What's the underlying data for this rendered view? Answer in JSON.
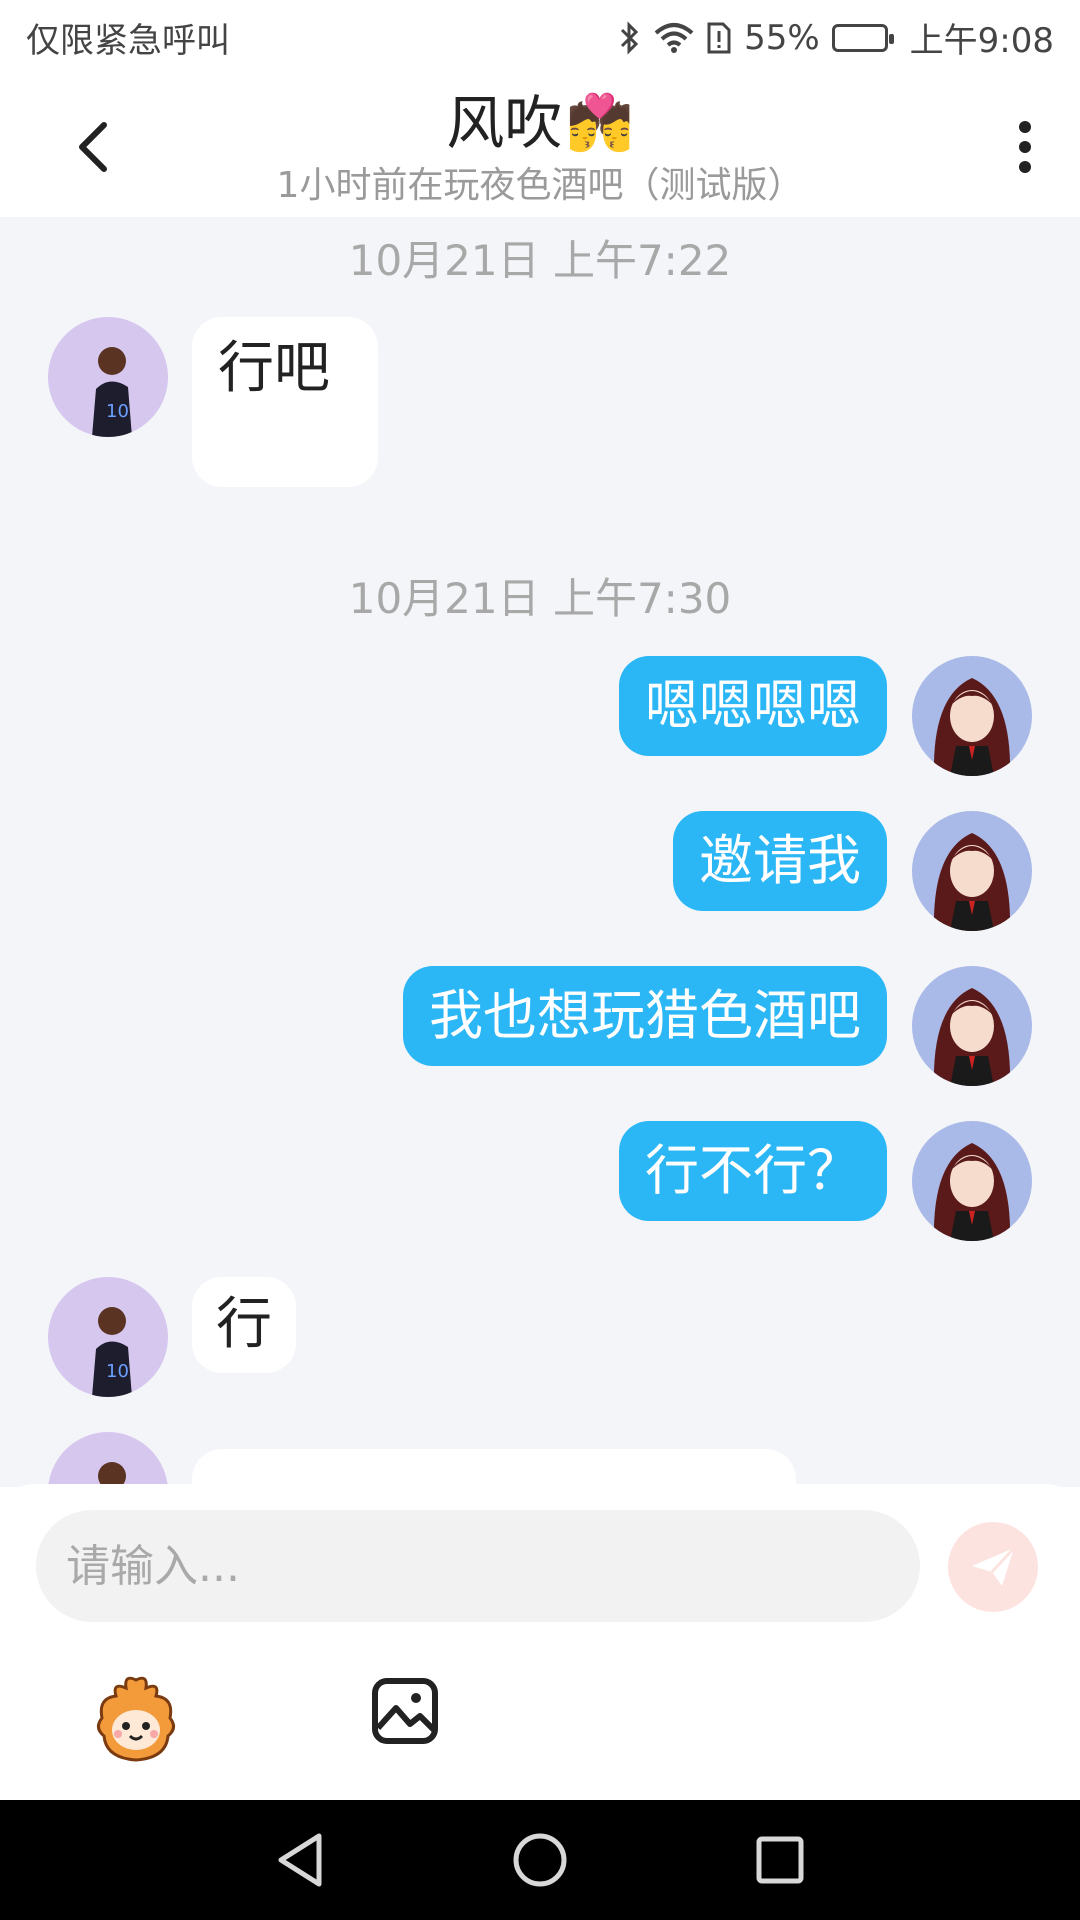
{
  "status_bar": {
    "left_text": "仅限紧急呼叫",
    "battery_percent": "55%",
    "time": "上午9:08",
    "battery_level": 0.55,
    "icons": [
      "bluetooth-icon",
      "wifi-icon",
      "alert-icon",
      "battery-icon"
    ]
  },
  "header": {
    "title": "风吹",
    "title_emoji": "💏",
    "subtitle": "1小时前在玩夜色酒吧（测试版）",
    "icons": [
      "back-arrow-icon",
      "more-vertical-icon"
    ]
  },
  "chat": {
    "timestamps": [
      "10月21日 上午7:22",
      "10月21日 上午7:30"
    ],
    "messages": [
      {
        "side": "in",
        "text": "行吧"
      },
      {
        "side": "out",
        "text": "嗯嗯嗯嗯"
      },
      {
        "side": "out",
        "text": "邀请我"
      },
      {
        "side": "out",
        "text": "我也想玩猎色酒吧"
      },
      {
        "side": "out",
        "text": "行不行？"
      },
      {
        "side": "in",
        "text": "行"
      }
    ]
  },
  "input": {
    "placeholder": "请输入...",
    "icons": [
      "send-icon",
      "emoji-mascot-icon",
      "image-icon"
    ]
  },
  "colors": {
    "accent": "#2bb6f5",
    "chat_bg": "#f3f5f8",
    "send_disabled": "#fde3e0"
  },
  "nav_bar": {
    "icons": [
      "nav-back-icon",
      "nav-home-icon",
      "nav-recents-icon"
    ]
  }
}
